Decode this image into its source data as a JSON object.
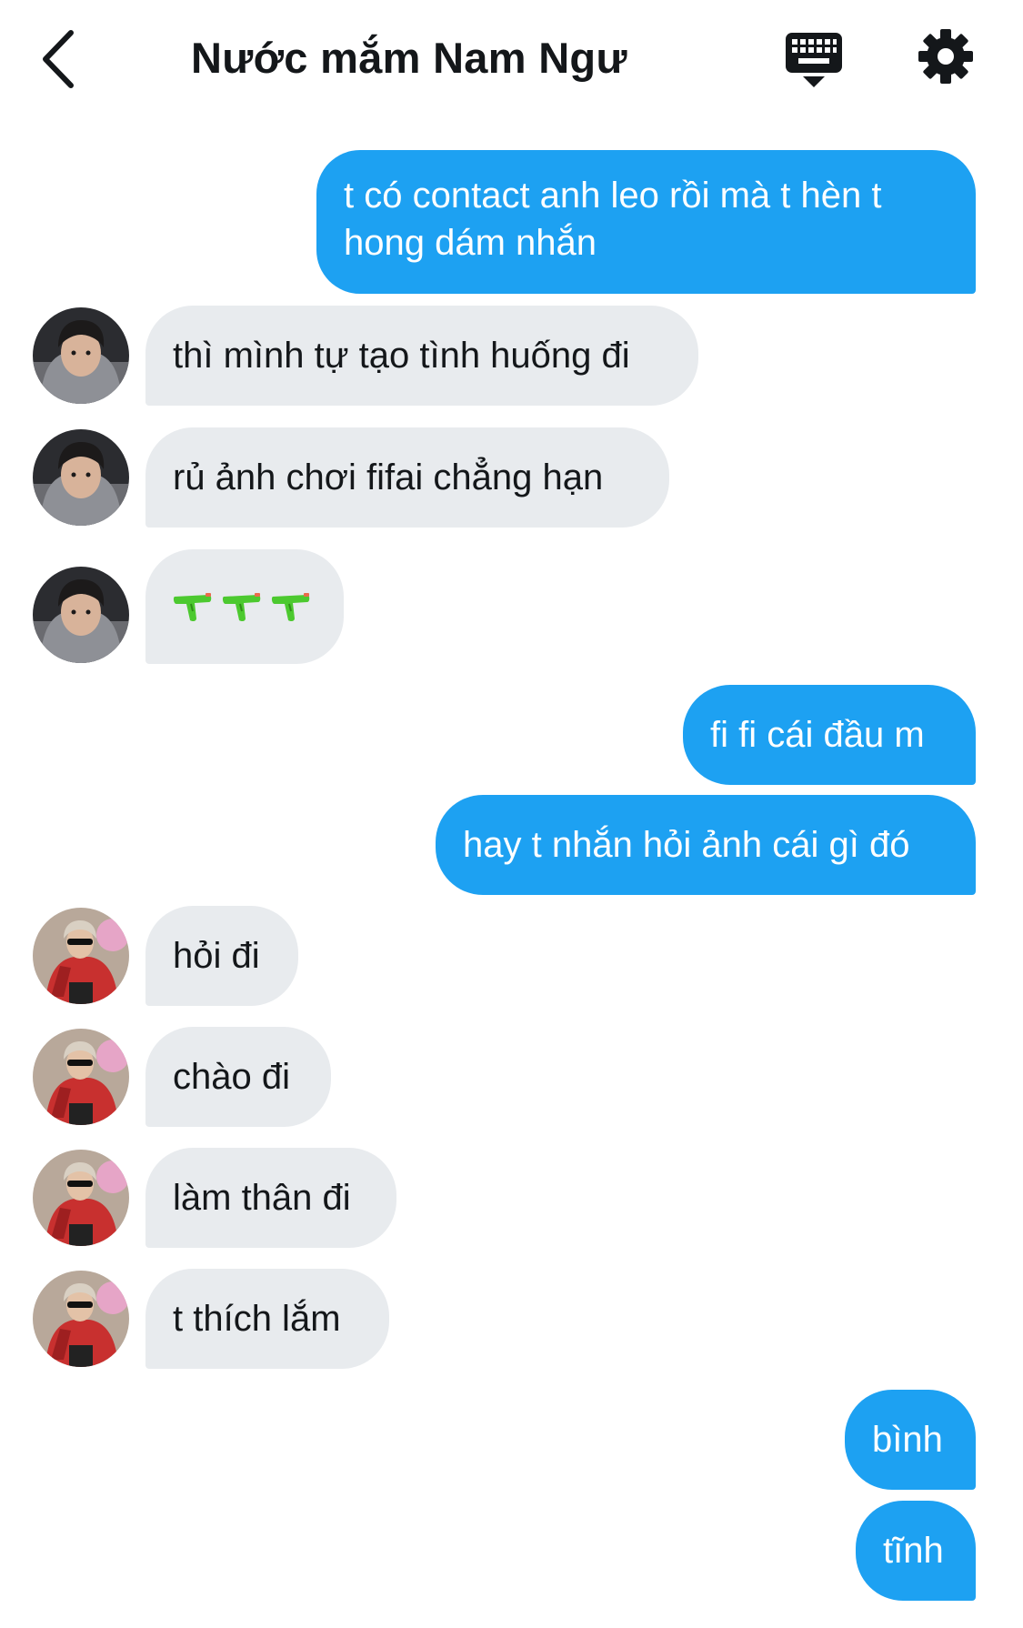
{
  "header": {
    "title": "Nước mắm Nam Ngư"
  },
  "icons": {
    "back": "chevron-left-icon",
    "keyboard": "keyboard-icon",
    "settings": "gear-icon",
    "emoji": "water-pistol-emoji"
  },
  "colors": {
    "outgoing_bubble": "#1da1f2",
    "incoming_bubble": "#e8ebee",
    "icon": "#14171a"
  },
  "messages": [
    {
      "from": "me",
      "text": "t có contact anh leo rồi mà t hèn t hong dám nhắn"
    },
    {
      "from": "them-1",
      "text": "thì mình tự tạo tình huống đi"
    },
    {
      "from": "them-1",
      "text": "rủ ảnh chơi fifai chẳng hạn"
    },
    {
      "from": "them-1",
      "text": "",
      "emoji": "water-pistol",
      "emoji_count": 3
    },
    {
      "from": "me",
      "text": "fi fi cái đầu m"
    },
    {
      "from": "me",
      "text": "hay t nhắn hỏi ảnh cái gì đó"
    },
    {
      "from": "them-2",
      "text": "hỏi đi"
    },
    {
      "from": "them-2",
      "text": "chào đi"
    },
    {
      "from": "them-2",
      "text": "làm thân đi"
    },
    {
      "from": "them-2",
      "text": "t thích lắm"
    },
    {
      "from": "me",
      "text": "bình"
    },
    {
      "from": "me",
      "text": "tĩnh"
    }
  ]
}
